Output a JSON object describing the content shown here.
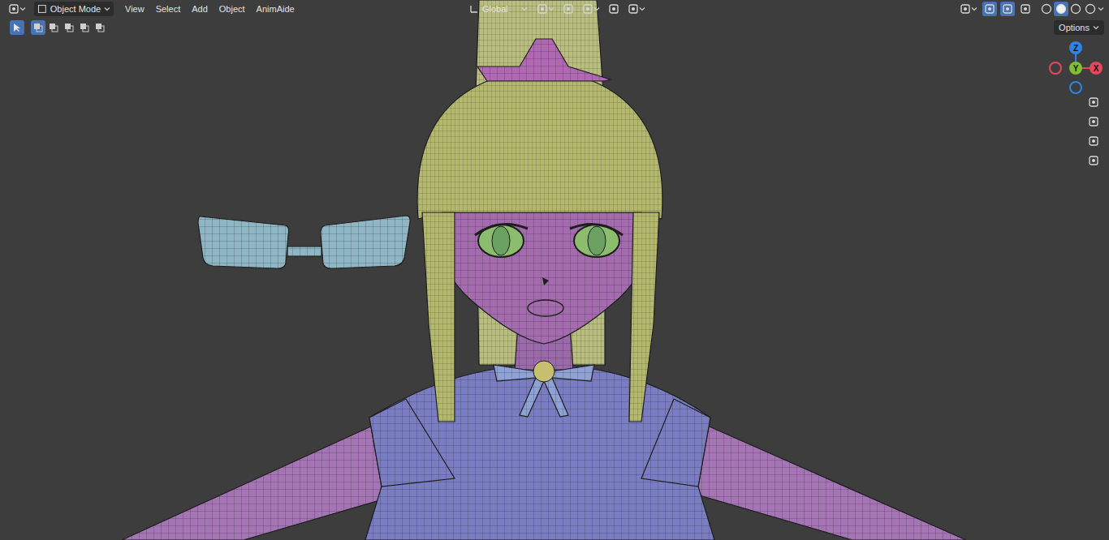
{
  "header": {
    "mode": "Object Mode",
    "menus": [
      "View",
      "Select",
      "Add",
      "Object",
      "AnimAide"
    ],
    "orientation": "Global",
    "toggles": [
      {
        "name": "gizmos",
        "on": true
      },
      {
        "name": "overlays",
        "on": true
      },
      {
        "name": "xray",
        "on": false
      }
    ],
    "shading": [
      {
        "name": "wireframe",
        "selected": false
      },
      {
        "name": "solid",
        "selected": true
      },
      {
        "name": "material",
        "selected": false
      },
      {
        "name": "rendered",
        "selected": false
      }
    ]
  },
  "toolbar": {
    "tool_selected": true,
    "select_modes": [
      {
        "selected": true
      },
      {
        "selected": false
      },
      {
        "selected": false
      },
      {
        "selected": false
      },
      {
        "selected": false
      }
    ],
    "options": "Options"
  },
  "gizmo": {
    "axes": [
      {
        "label": "Z",
        "color": "#2e84e6"
      },
      {
        "label": "Y",
        "color": "#7fbf2f"
      },
      {
        "label": "X",
        "color": "#e5485a"
      }
    ]
  }
}
